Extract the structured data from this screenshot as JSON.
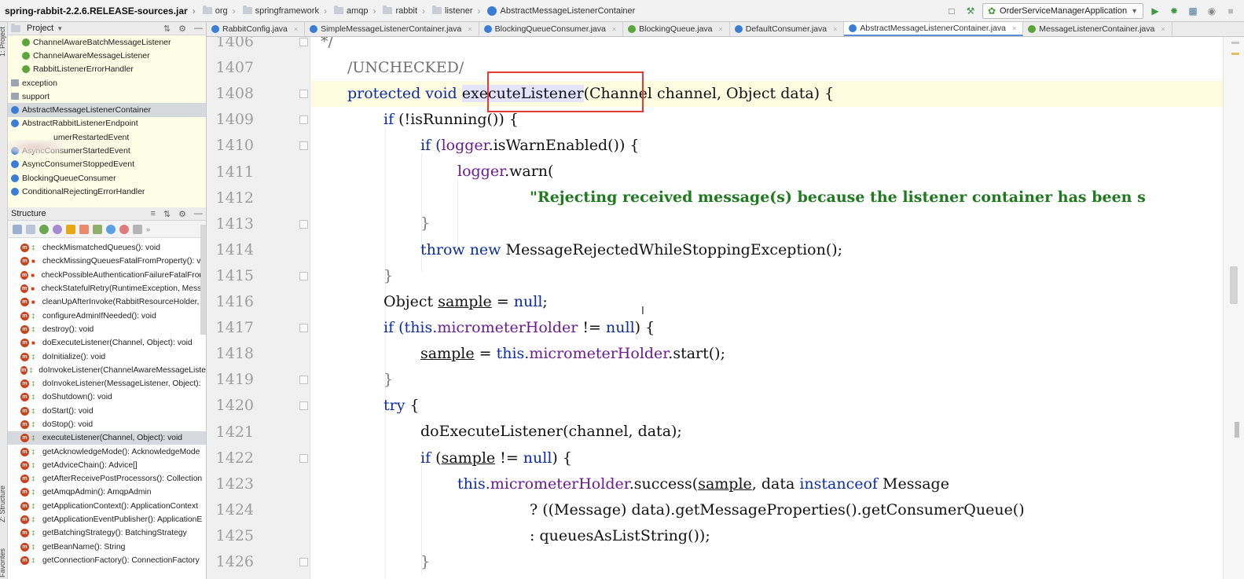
{
  "breadcrumbs": [
    "spring-rabbit-2.2.6.RELEASE-sources.jar",
    "org",
    "springframework",
    "amqp",
    "rabbit",
    "listener",
    "AbstractMessageListenerContainer"
  ],
  "run_config": "OrderServiceManagerApplication",
  "side_labels": {
    "project": "1: Project",
    "structure": "Z: Structure",
    "favorites": "Favorites"
  },
  "project_panel": {
    "title": "Project",
    "items": [
      {
        "label": "ChannelAwareBatchMessageListener",
        "kind": "spring",
        "indent": 18
      },
      {
        "label": "ChannelAwareMessageListener",
        "kind": "spring",
        "indent": 18
      },
      {
        "label": "RabbitListenerErrorHandler",
        "kind": "spring",
        "indent": 18
      },
      {
        "label": "exception",
        "kind": "package",
        "indent": 4
      },
      {
        "label": "support",
        "kind": "package",
        "indent": 4
      },
      {
        "label": "AbstractMessageListenerContainer",
        "kind": "class",
        "indent": 4,
        "selected": true
      },
      {
        "label": "AbstractRabbitListenerEndpoint",
        "kind": "class",
        "indent": 4
      },
      {
        "label": "umerRestartedEvent",
        "kind": "class",
        "indent": 58
      },
      {
        "label": "AsyncConsumerStartedEvent",
        "kind": "class",
        "indent": 4
      },
      {
        "label": "AsyncConsumerStoppedEvent",
        "kind": "class",
        "indent": 4
      },
      {
        "label": "BlockingQueueConsumer",
        "kind": "class",
        "indent": 4
      },
      {
        "label": "ConditionalRejectingErrorHandler",
        "kind": "class",
        "indent": 4
      }
    ]
  },
  "structure_panel": {
    "title": "Structure",
    "members": [
      {
        "label": "checkMismatchedQueues(): void",
        "vis": "green"
      },
      {
        "label": "checkMissingQueuesFatalFromProperty(): vo",
        "vis": "red"
      },
      {
        "label": "checkPossibleAuthenticationFailureFatalFrom",
        "vis": "red"
      },
      {
        "label": "checkStatefulRetry(RuntimeException, Messa",
        "vis": "red"
      },
      {
        "label": "cleanUpAfterInvoke(RabbitResourceHolder, b",
        "vis": "red"
      },
      {
        "label": "configureAdminIfNeeded(): void",
        "vis": "green"
      },
      {
        "label": "destroy(): void",
        "vis": "green"
      },
      {
        "label": "doExecuteListener(Channel, Object): void",
        "vis": "red"
      },
      {
        "label": "doInitialize(): void",
        "vis": "green"
      },
      {
        "label": "doInvokeListener(ChannelAwareMessageListe",
        "vis": "green"
      },
      {
        "label": "doInvokeListener(MessageListener, Object):",
        "vis": "green"
      },
      {
        "label": "doShutdown(): void",
        "vis": "green"
      },
      {
        "label": "doStart(): void",
        "vis": "green"
      },
      {
        "label": "doStop(): void",
        "vis": "green"
      },
      {
        "label": "executeListener(Channel, Object): void",
        "vis": "green",
        "selected": true
      },
      {
        "label": "getAcknowledgeMode(): AcknowledgeMode",
        "vis": "green"
      },
      {
        "label": "getAdviceChain(): Advice[]",
        "vis": "green"
      },
      {
        "label": "getAfterReceivePostProcessors(): Collection",
        "vis": "green"
      },
      {
        "label": "getAmqpAdmin(): AmqpAdmin",
        "vis": "green"
      },
      {
        "label": "getApplicationContext(): ApplicationContext",
        "vis": "green"
      },
      {
        "label": "getApplicationEventPublisher(): ApplicationE",
        "vis": "green"
      },
      {
        "label": "getBatchingStrategy(): BatchingStrategy",
        "vis": "green"
      },
      {
        "label": "getBeanName(): String",
        "vis": "green"
      },
      {
        "label": "getConnectionFactory(): ConnectionFactory",
        "vis": "green"
      }
    ]
  },
  "tabs": [
    {
      "label": "RabbitConfig.java",
      "kind": "c"
    },
    {
      "label": "SimpleMessageListenerContainer.java",
      "kind": "c"
    },
    {
      "label": "BlockingQueueConsumer.java",
      "kind": "c"
    },
    {
      "label": "BlockingQueue.java",
      "kind": "i"
    },
    {
      "label": "DefaultConsumer.java",
      "kind": "c"
    },
    {
      "label": "AbstractMessageListenerContainer.java",
      "kind": "c",
      "active": true
    },
    {
      "label": "MessageListenerContainer.java",
      "kind": "i"
    }
  ],
  "editor": {
    "line_numbers": [
      "1406",
      "1407",
      "1408",
      "1409",
      "1410",
      "1411",
      "1412",
      "1413",
      "1414",
      "1415",
      "1416",
      "1417",
      "1418",
      "1419",
      "1420",
      "1421",
      "1422",
      "1423",
      "1424",
      "1425",
      "1426"
    ],
    "code": {
      "l1406": "*/",
      "l1407": "/UNCHECKED/",
      "l1408_kw": "protected void ",
      "l1408_name": "executeListener",
      "l1408_rest": "(Channel channel, Object data) {",
      "l1409": "if (!isRunning()) {",
      "l1410_a": "if (",
      "l1410_f": "logger",
      "l1410_b": ".isWarnEnabled()) {",
      "l1411_f": "logger",
      "l1411_b": ".warn(",
      "l1412": "\"Rejecting received message(s) because the listener container has been s",
      "l1413": "}",
      "l1414_kw": "throw new ",
      "l1414_rest": "MessageRejectedWhileStoppingException();",
      "l1415": "}",
      "l1416_a": "Object ",
      "l1416_var": "sample",
      "l1416_b": " = ",
      "l1416_kw": "null",
      "l1416_c": ";",
      "l1417_kw": "if (this.",
      "l1417_f": "micrometerHolder",
      "l1417_b": " != ",
      "l1417_kw2": "null",
      "l1417_c": ") {",
      "l1418_var": "sample",
      "l1418_a": " = ",
      "l1418_kw": "this.",
      "l1418_f": "micrometerHolder",
      "l1418_b": ".start();",
      "l1419": "}",
      "l1420_kw": "try",
      "l1420_b": " {",
      "l1421": "doExecuteListener(channel, data);",
      "l1422_kw": "if",
      "l1422_a": " (",
      "l1422_var": "sample",
      "l1422_b": " != ",
      "l1422_kw2": "null",
      "l1422_c": ") {",
      "l1423_kw": "this.",
      "l1423_f": "micrometerHolder",
      "l1423_a": ".success(",
      "l1423_var": "sample",
      "l1423_b": ", data ",
      "l1423_kw2": "instanceof",
      "l1423_c": " Message",
      "l1424": "? ((Message) data).getMessageProperties().getConsumerQueue()",
      "l1425": ": queuesAsListString());",
      "l1426": "}"
    }
  },
  "colors": {
    "keyword": "#0c2da6",
    "field": "#6a1b91",
    "string": "#1f7a1f",
    "highlight_box": "#e53935"
  }
}
